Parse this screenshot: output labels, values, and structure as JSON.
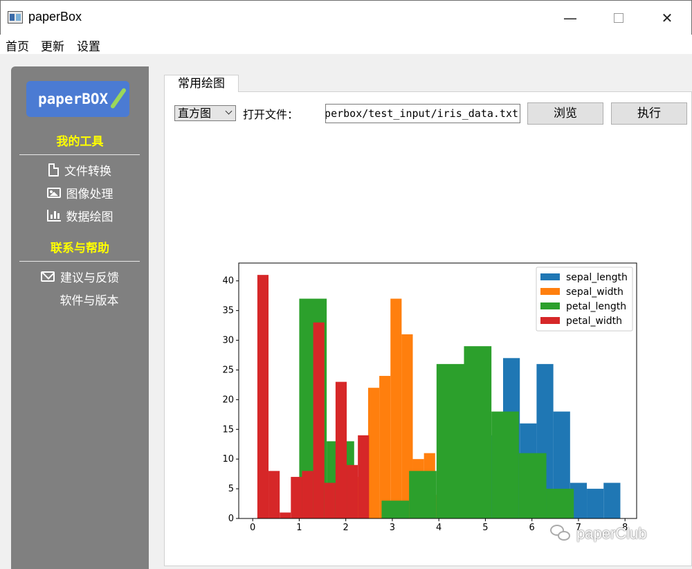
{
  "window": {
    "title": "paperBox"
  },
  "menu": {
    "home": "首页",
    "update": "更新",
    "settings": "设置"
  },
  "sidebar": {
    "logo": "paperBOX",
    "tools_heading": "我的工具",
    "tools": [
      {
        "label": "文件转换",
        "icon": "file-icon"
      },
      {
        "label": "图像处理",
        "icon": "image-icon"
      },
      {
        "label": "数据绘图",
        "icon": "bar-chart-icon"
      }
    ],
    "help_heading": "联系与帮助",
    "help": [
      {
        "label": "建议与反馈",
        "icon": "mail-icon"
      },
      {
        "label": "软件与版本",
        "icon": "windows-icon"
      }
    ]
  },
  "tab": {
    "label": "常用绘图"
  },
  "controls": {
    "plot_type": "直方图",
    "open_file_label": "打开文件：",
    "file_path": "aperbox/test_input/iris_data.txt",
    "browse": "浏览",
    "run": "执行"
  },
  "watermark": {
    "text": "paperClub"
  },
  "colors": {
    "sidebar": "#808080",
    "accent_heading": "#ffff00",
    "logo_bg": "#4b7bd3"
  },
  "chart_data": {
    "type": "bar",
    "subtype": "histogram",
    "xlim": [
      -0.3,
      8.25
    ],
    "ylim": [
      0,
      43
    ],
    "xticks": [
      0,
      1,
      2,
      3,
      4,
      5,
      6,
      7,
      8
    ],
    "yticks": [
      0,
      5,
      10,
      15,
      20,
      25,
      30,
      35,
      40
    ],
    "legend_position": "top-right",
    "series": [
      {
        "name": "sepal_length",
        "color": "#1f77b4",
        "start": 4.3,
        "width": 0.36,
        "counts": [
          9,
          23,
          14,
          27,
          16,
          26,
          18,
          6,
          5,
          6
        ]
      },
      {
        "name": "sepal_width",
        "color": "#ff7f0e",
        "start": 2.0,
        "width": 0.24,
        "counts": [
          4,
          7,
          22,
          24,
          37,
          31,
          10,
          11,
          4,
          0
        ]
      },
      {
        "name": "petal_length",
        "color": "#2ca02c",
        "start": 1.0,
        "width": 0.59,
        "counts": [
          37,
          13,
          0,
          3,
          8,
          26,
          29,
          18,
          11,
          5
        ]
      },
      {
        "name": "petal_width",
        "color": "#d62728",
        "start": 0.1,
        "width": 0.24,
        "counts": [
          41,
          8,
          1,
          7,
          8,
          33,
          6,
          23,
          9,
          14
        ]
      }
    ]
  }
}
